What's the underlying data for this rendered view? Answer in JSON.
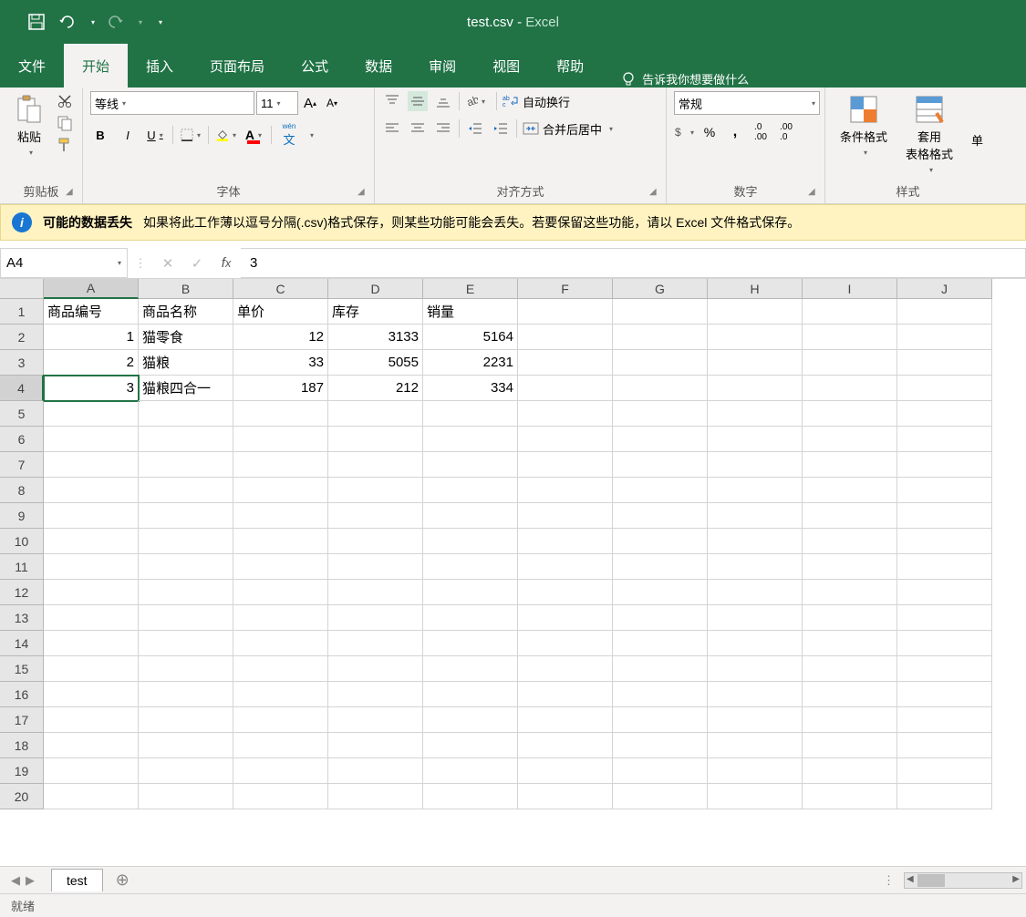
{
  "title": {
    "filename": "test.csv",
    "sep": " - ",
    "app": "Excel"
  },
  "tabs": [
    "文件",
    "开始",
    "插入",
    "页面布局",
    "公式",
    "数据",
    "审阅",
    "视图",
    "帮助"
  ],
  "active_tab": 1,
  "tell_me": "告诉我你想要做什么",
  "ribbon": {
    "clipboard": {
      "paste": "粘贴",
      "label": "剪贴板"
    },
    "font": {
      "name": "等线",
      "size": "11",
      "label": "字体",
      "bold": "B",
      "italic": "I",
      "underline": "U",
      "ruby": "文",
      "ruby_top": "wén"
    },
    "align": {
      "wrap": "自动换行",
      "merge": "合并后居中",
      "label": "对齐方式"
    },
    "number": {
      "format": "常规",
      "label": "数字"
    },
    "styles": {
      "cond": "条件格式",
      "tablefmt": "套用\n表格格式",
      "label": "样式",
      "cell": "单"
    }
  },
  "msgbar": {
    "title": "可能的数据丢失",
    "text": "如果将此工作薄以逗号分隔(.csv)格式保存，则某些功能可能会丢失。若要保留这些功能，请以 Excel 文件格式保存。"
  },
  "namebox": "A4",
  "formula": "3",
  "columns": [
    "A",
    "B",
    "C",
    "D",
    "E",
    "F",
    "G",
    "H",
    "I",
    "J"
  ],
  "selected_col": 0,
  "selected_row": 4,
  "rows": [
    {
      "r": 1,
      "cells": [
        "商品编号",
        "商品名称",
        "单价",
        "库存",
        "销量",
        "",
        "",
        "",
        "",
        ""
      ],
      "align": [
        "l",
        "l",
        "l",
        "l",
        "l",
        "l",
        "l",
        "l",
        "l",
        "l"
      ]
    },
    {
      "r": 2,
      "cells": [
        "1",
        "猫零食",
        "12",
        "3133",
        "5164",
        "",
        "",
        "",
        "",
        ""
      ],
      "align": [
        "r",
        "l",
        "r",
        "r",
        "r",
        "l",
        "l",
        "l",
        "l",
        "l"
      ]
    },
    {
      "r": 3,
      "cells": [
        "2",
        "猫粮",
        "33",
        "5055",
        "2231",
        "",
        "",
        "",
        "",
        ""
      ],
      "align": [
        "r",
        "l",
        "r",
        "r",
        "r",
        "l",
        "l",
        "l",
        "l",
        "l"
      ]
    },
    {
      "r": 4,
      "cells": [
        "3",
        "猫粮四合一",
        "187",
        "212",
        "334",
        "",
        "",
        "",
        "",
        ""
      ],
      "align": [
        "r",
        "l",
        "r",
        "r",
        "r",
        "l",
        "l",
        "l",
        "l",
        "l"
      ]
    },
    {
      "r": 5,
      "cells": [
        "",
        "",
        "",
        "",
        "",
        "",
        "",
        "",
        "",
        ""
      ],
      "align": [
        "l",
        "l",
        "l",
        "l",
        "l",
        "l",
        "l",
        "l",
        "l",
        "l"
      ]
    },
    {
      "r": 6,
      "cells": [
        "",
        "",
        "",
        "",
        "",
        "",
        "",
        "",
        "",
        ""
      ],
      "align": [
        "l",
        "l",
        "l",
        "l",
        "l",
        "l",
        "l",
        "l",
        "l",
        "l"
      ]
    },
    {
      "r": 7,
      "cells": [
        "",
        "",
        "",
        "",
        "",
        "",
        "",
        "",
        "",
        ""
      ],
      "align": [
        "l",
        "l",
        "l",
        "l",
        "l",
        "l",
        "l",
        "l",
        "l",
        "l"
      ]
    },
    {
      "r": 8,
      "cells": [
        "",
        "",
        "",
        "",
        "",
        "",
        "",
        "",
        "",
        ""
      ],
      "align": [
        "l",
        "l",
        "l",
        "l",
        "l",
        "l",
        "l",
        "l",
        "l",
        "l"
      ]
    },
    {
      "r": 9,
      "cells": [
        "",
        "",
        "",
        "",
        "",
        "",
        "",
        "",
        "",
        ""
      ],
      "align": [
        "l",
        "l",
        "l",
        "l",
        "l",
        "l",
        "l",
        "l",
        "l",
        "l"
      ]
    },
    {
      "r": 10,
      "cells": [
        "",
        "",
        "",
        "",
        "",
        "",
        "",
        "",
        "",
        ""
      ],
      "align": [
        "l",
        "l",
        "l",
        "l",
        "l",
        "l",
        "l",
        "l",
        "l",
        "l"
      ]
    },
    {
      "r": 11,
      "cells": [
        "",
        "",
        "",
        "",
        "",
        "",
        "",
        "",
        "",
        ""
      ],
      "align": [
        "l",
        "l",
        "l",
        "l",
        "l",
        "l",
        "l",
        "l",
        "l",
        "l"
      ]
    },
    {
      "r": 12,
      "cells": [
        "",
        "",
        "",
        "",
        "",
        "",
        "",
        "",
        "",
        ""
      ],
      "align": [
        "l",
        "l",
        "l",
        "l",
        "l",
        "l",
        "l",
        "l",
        "l",
        "l"
      ]
    },
    {
      "r": 13,
      "cells": [
        "",
        "",
        "",
        "",
        "",
        "",
        "",
        "",
        "",
        ""
      ],
      "align": [
        "l",
        "l",
        "l",
        "l",
        "l",
        "l",
        "l",
        "l",
        "l",
        "l"
      ]
    },
    {
      "r": 14,
      "cells": [
        "",
        "",
        "",
        "",
        "",
        "",
        "",
        "",
        "",
        ""
      ],
      "align": [
        "l",
        "l",
        "l",
        "l",
        "l",
        "l",
        "l",
        "l",
        "l",
        "l"
      ]
    },
    {
      "r": 15,
      "cells": [
        "",
        "",
        "",
        "",
        "",
        "",
        "",
        "",
        "",
        ""
      ],
      "align": [
        "l",
        "l",
        "l",
        "l",
        "l",
        "l",
        "l",
        "l",
        "l",
        "l"
      ]
    },
    {
      "r": 16,
      "cells": [
        "",
        "",
        "",
        "",
        "",
        "",
        "",
        "",
        "",
        ""
      ],
      "align": [
        "l",
        "l",
        "l",
        "l",
        "l",
        "l",
        "l",
        "l",
        "l",
        "l"
      ]
    },
    {
      "r": 17,
      "cells": [
        "",
        "",
        "",
        "",
        "",
        "",
        "",
        "",
        "",
        ""
      ],
      "align": [
        "l",
        "l",
        "l",
        "l",
        "l",
        "l",
        "l",
        "l",
        "l",
        "l"
      ]
    },
    {
      "r": 18,
      "cells": [
        "",
        "",
        "",
        "",
        "",
        "",
        "",
        "",
        "",
        ""
      ],
      "align": [
        "l",
        "l",
        "l",
        "l",
        "l",
        "l",
        "l",
        "l",
        "l",
        "l"
      ]
    },
    {
      "r": 19,
      "cells": [
        "",
        "",
        "",
        "",
        "",
        "",
        "",
        "",
        "",
        ""
      ],
      "align": [
        "l",
        "l",
        "l",
        "l",
        "l",
        "l",
        "l",
        "l",
        "l",
        "l"
      ]
    },
    {
      "r": 20,
      "cells": [
        "",
        "",
        "",
        "",
        "",
        "",
        "",
        "",
        "",
        ""
      ],
      "align": [
        "l",
        "l",
        "l",
        "l",
        "l",
        "l",
        "l",
        "l",
        "l",
        "l"
      ]
    }
  ],
  "sheet": {
    "name": "test"
  },
  "status": "就绪"
}
